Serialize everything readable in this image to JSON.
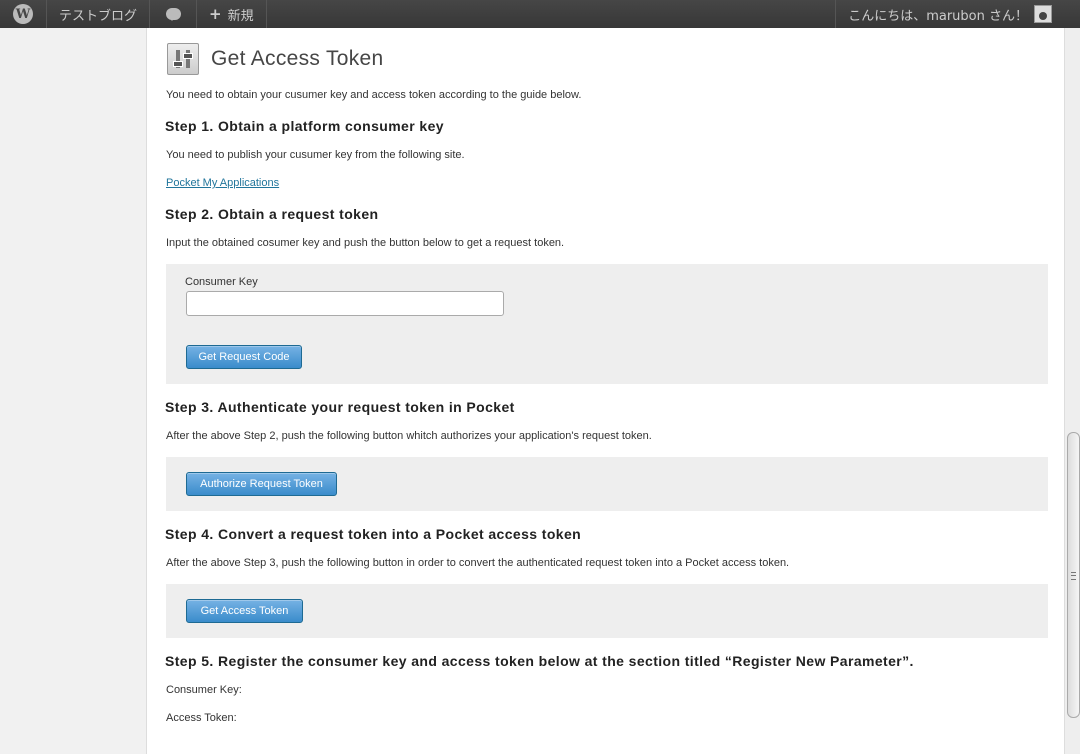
{
  "adminbar": {
    "site_name": "テストブログ",
    "new_label": "新規",
    "greeting": "こんにちは、marubon さん！"
  },
  "page": {
    "title": "Get Access Token",
    "intro": "You need to obtain your cusumer key and access token according to the guide below."
  },
  "step1": {
    "heading": "Step 1. Obtain a platform consumer key",
    "text": "You need to publish your cusumer key from the following site.",
    "link": "Pocket My Applications"
  },
  "step2": {
    "heading": "Step 2. Obtain a request token",
    "text": "Input the obtained cosumer key and push the button below to get a request token.",
    "field_label": "Consumer Key",
    "field_value": "",
    "button": "Get Request Code"
  },
  "step3": {
    "heading": "Step 3. Authenticate your request token in Pocket",
    "text": "After the above Step 2, push the following button whitch authorizes your application's request token.",
    "button": "Authorize Request Token"
  },
  "step4": {
    "heading": "Step 4. Convert a request token into a Pocket access token",
    "text": "After the above Step 3, push the following button in order to convert the authenticated request token into a Pocket access token.",
    "button": "Get Access Token"
  },
  "step5": {
    "heading": "Step 5. Register the consumer key and access token below at the section titled “Register New Parameter”.",
    "consumer_key_label": "Consumer Key:",
    "access_token_label": "Access Token:"
  }
}
